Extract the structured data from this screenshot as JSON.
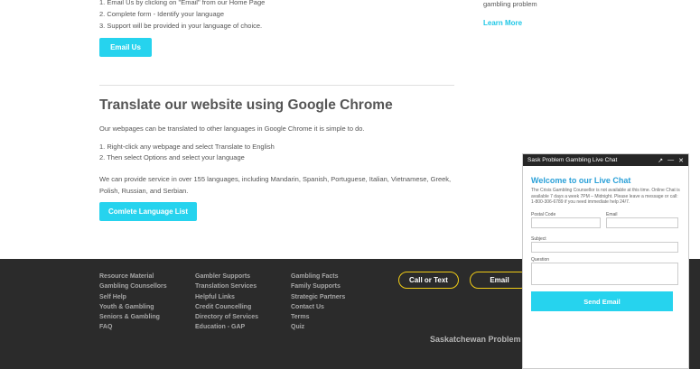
{
  "top": {
    "steps": [
      "1. Email Us by clicking on \"Email\" from our Home Page",
      "2. Complete form - Identify your language",
      "3. Support will be provided in your language of choice."
    ],
    "email_us_label": "Email Us"
  },
  "side": {
    "text": "gambling problem",
    "learn_more": "Learn More"
  },
  "translate": {
    "heading": "Translate our website using Google Chrome",
    "intro": "Our webpages can be translated to other languages in Google Chrome it is simple to do.",
    "steps": [
      "1. Right-click any webpage and select Translate to English",
      "2. Then select Options and select your language"
    ],
    "languages_text": "We can provide service in over 155 languages, including Mandarin, Spanish, Portuguese, Italian, Vietnamese, Greek, Polish, Russian, and Serbian.",
    "list_button": "Comlete Language List"
  },
  "footer": {
    "col1": [
      "Resource Material",
      "Gambling Counsellors",
      "Self Help",
      "Youth & Gambling",
      "Seniors & Gambling",
      "FAQ"
    ],
    "col2": [
      "Gambler Supports",
      "Translation Services",
      "Helpful Links",
      "Credit Councelling",
      "Directory of Services",
      "Education - GAP"
    ],
    "col3": [
      "Gambling Facts",
      "Family Supports",
      "Strategic Partners",
      "Contact Us",
      "Terms",
      "Quiz"
    ],
    "call_label": "Call or Text",
    "email_label": "Email",
    "org_title": "Saskatchewan Problem"
  },
  "chat": {
    "header_title": "Sask Problem Gambling Live Chat",
    "title": "Welcome to our Live Chat",
    "info": "The Crisis Gambling Counsellor is not available at this time. Online Chat is available 7 days a week 7PM – Midnight. Please leave a message or call: 1-800-306-6789 if you need immediate help 24/7.",
    "postal_label": "Postal Code",
    "email_label": "Email",
    "subject_label": "Subject",
    "question_label": "Question",
    "send_label": "Send Email",
    "icons": [
      "expand-icon",
      "minimize-icon",
      "close-icon"
    ]
  },
  "colors": {
    "accent": "#26d3ee",
    "footer_bg": "#2b2b2b",
    "pill_border": "#f0cc16",
    "chat_title": "#2aa0d8"
  }
}
